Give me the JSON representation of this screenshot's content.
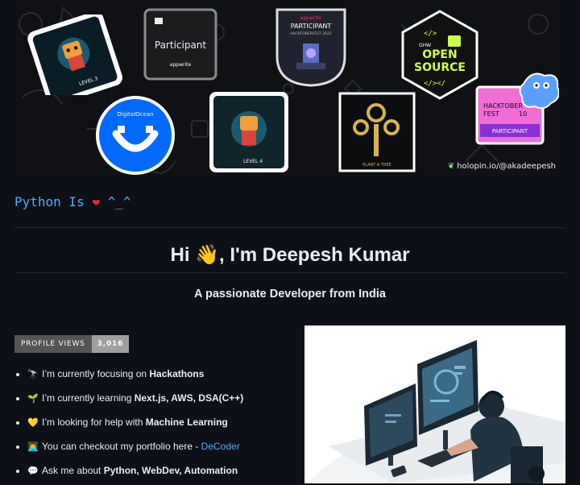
{
  "banner": {
    "holopin_link": "holopin.io/@akadeepesh",
    "badges": {
      "level3": "LEVEL 3",
      "participant_title": "Participant",
      "participant_brand": "appwrite",
      "appwrite_small": "appwrite",
      "appwrite_participant": "PARTICIPANT",
      "appwrite_fest": "HACKTOBERFEST 2022",
      "ghw": "GHW",
      "open_source_line1": "OPEN",
      "open_source_line2": "SOURCE",
      "digitalocean": "DigitalOcean",
      "level4": "LEVEL 4",
      "plant_tree": "PLANT A TREE",
      "hacktoberfest_line1": "HACKTOBER",
      "hacktoberfest_line2": "FEST",
      "hacktoberfest_num": "10",
      "hacktoberfest_participant": "PARTICIPANT"
    }
  },
  "intro": {
    "python_prefix": "Python Is ",
    "python_heart": "❤",
    "python_suffix": " ^_^",
    "greeting": "Hi 👋, I'm Deepesh Kumar",
    "subtitle": "A passionate Developer from India"
  },
  "profile_views": {
    "label": "PROFILE VIEWS",
    "value": "3,016"
  },
  "facts": [
    {
      "emoji": "🔭",
      "text": "I’m currently focusing on ",
      "bold": "Hackathons"
    },
    {
      "emoji": "🌱",
      "text": "I’m currently learning ",
      "bold": "Next.js, AWS, DSA(C++)"
    },
    {
      "emoji": "💛",
      "text": "I’m looking for help with ",
      "bold": "Machine Learning"
    },
    {
      "emoji": "👨‍💻",
      "text": "You can checkout my portfolio here - ",
      "link": "DeCoder"
    },
    {
      "emoji": "💬",
      "text": "Ask me about ",
      "bold": "Python, WebDev, Automation"
    }
  ],
  "colors": {
    "background": "#0d1117",
    "link": "#58a6ff",
    "heart": "#e5283b",
    "badge_label": "#555555",
    "badge_value": "#9f9f9f"
  }
}
